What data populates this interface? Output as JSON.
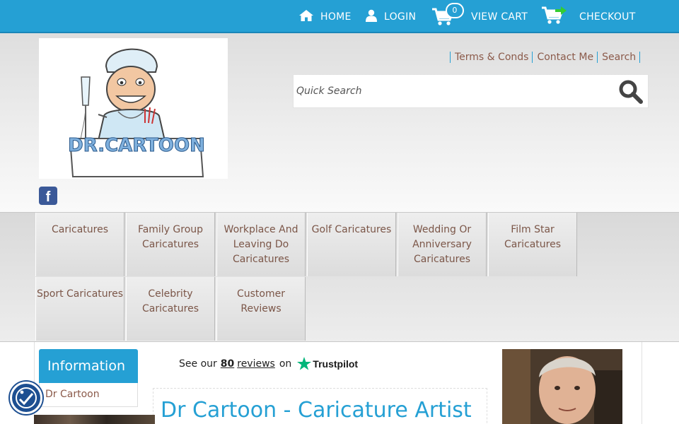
{
  "topnav": {
    "home_label": "HOME",
    "login_label": "LOGIN",
    "cart_count": "0",
    "view_cart_label": "VIEW CART",
    "checkout_label": "CHECKOUT"
  },
  "header": {
    "logo_text": "DR.CARTOON",
    "social": "f",
    "links": [
      "Terms & Conds",
      "Contact Me",
      "Search"
    ],
    "search_placeholder": "Quick Search"
  },
  "menu": {
    "items": [
      "Caricatures",
      "Family Group Caricatures",
      "Workplace And Leaving Do Caricatures",
      "Golf Caricatures",
      "Wedding Or Anniversary Caricatures",
      "Film Star Caricatures",
      "Sport Caricatures",
      "Celebrity Caricatures",
      "Customer Reviews"
    ]
  },
  "sidebar": {
    "heading": "Information",
    "items": [
      "Dr Cartoon"
    ]
  },
  "trustpilot": {
    "prefix": "See our",
    "count": "80",
    "reviews_word": "reviews",
    "on_word": "on",
    "brand": "Trustpilot"
  },
  "main": {
    "title": "Dr Cartoon - Caricature Artist"
  },
  "colors": {
    "accent": "#25a0d4",
    "link": "#8b5a4a",
    "menu_text": "#7b5648",
    "trustpilot_star": "#00b67a"
  }
}
